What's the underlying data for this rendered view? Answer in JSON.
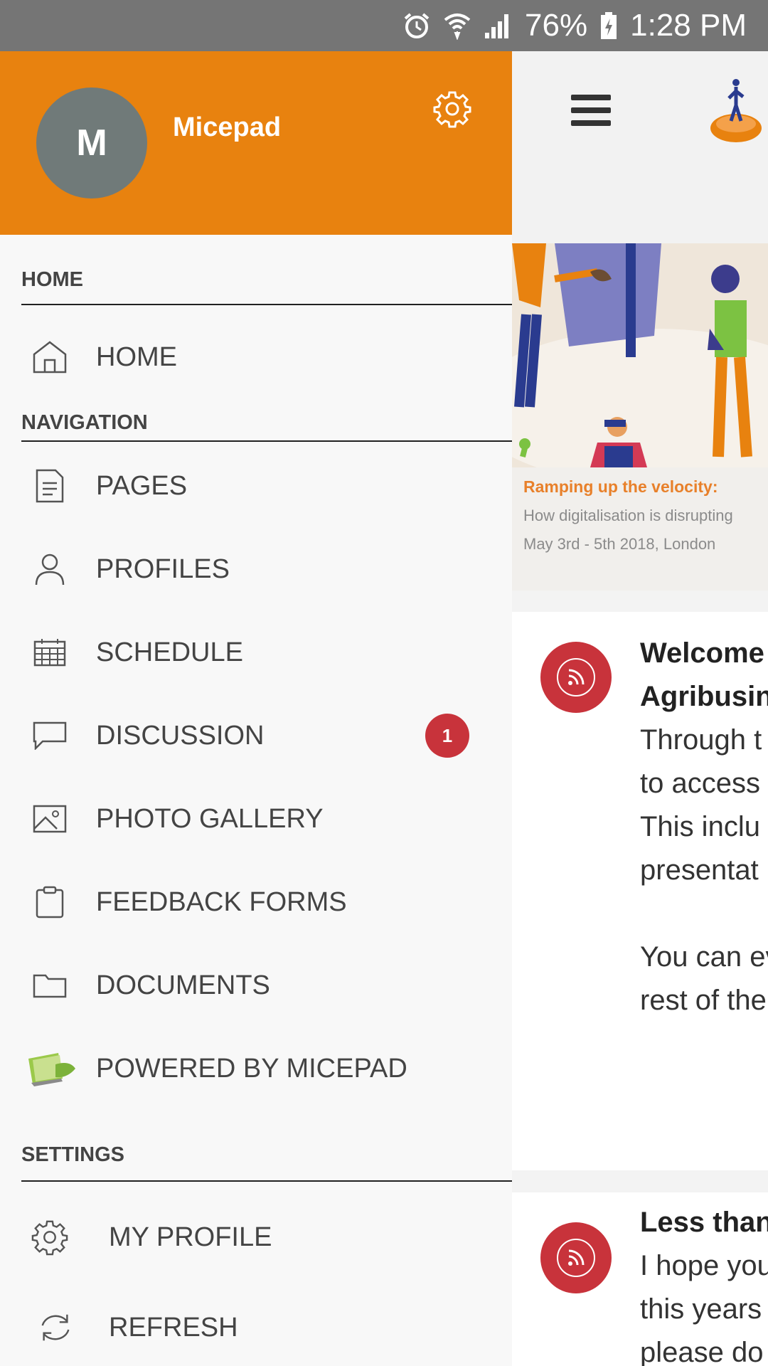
{
  "status_bar": {
    "battery": "76%",
    "time": "1:28 PM"
  },
  "drawer": {
    "avatar_initial": "M",
    "username": "Micepad",
    "sections": {
      "home": "HOME",
      "navigation": "NAVIGATION",
      "settings": "SETTINGS"
    },
    "home_items": [
      {
        "label": "HOME",
        "icon": "home-icon"
      }
    ],
    "nav_items": [
      {
        "label": "PAGES",
        "icon": "document-icon"
      },
      {
        "label": "PROFILES",
        "icon": "person-icon"
      },
      {
        "label": "SCHEDULE",
        "icon": "calendar-icon"
      },
      {
        "label": "DISCUSSION",
        "icon": "chat-bubble-icon",
        "badge": "1"
      },
      {
        "label": "PHOTO GALLERY",
        "icon": "image-icon"
      },
      {
        "label": "FEEDBACK FORMS",
        "icon": "clipboard-icon"
      },
      {
        "label": "DOCUMENTS",
        "icon": "folder-icon"
      },
      {
        "label": "POWERED BY MICEPAD",
        "icon": "micepad-logo-icon"
      }
    ],
    "settings_items": [
      {
        "label": "MY PROFILE",
        "icon": "gear-icon"
      },
      {
        "label": "REFRESH",
        "icon": "refresh-icon"
      }
    ]
  },
  "background": {
    "banner": {
      "title": "Ramping up the velocity:",
      "subtitle": "How digitalisation is disrupting",
      "date": "May 3rd - 5th 2018, London"
    },
    "posts": [
      {
        "title_lines": [
          "Welcome",
          "Agribusin"
        ],
        "body_lines": [
          "Through t",
          "to access",
          "This inclu",
          "presentat",
          "",
          "You can ev",
          "rest of the"
        ]
      },
      {
        "title_lines": [
          "Less than"
        ],
        "body_lines": [
          "I hope you",
          "this years",
          "please do"
        ]
      }
    ]
  },
  "colors": {
    "accent": "#e8820f",
    "badge": "#c8333b",
    "status_bar": "#757575"
  }
}
